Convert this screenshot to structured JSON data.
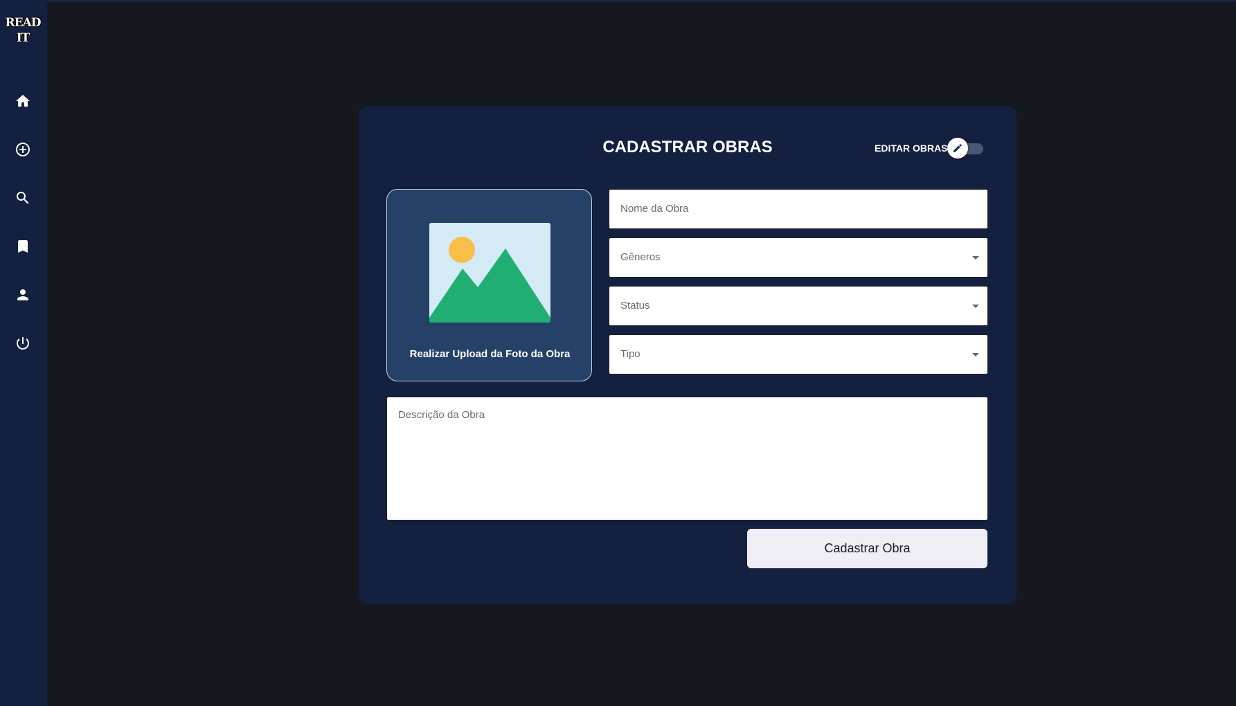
{
  "sidebar": {
    "logo_line1": "READ",
    "logo_line2": "IT",
    "items": [
      {
        "name": "home",
        "icon": "home-icon"
      },
      {
        "name": "add",
        "icon": "add-circle-icon"
      },
      {
        "name": "search",
        "icon": "search-icon"
      },
      {
        "name": "bookmarks",
        "icon": "bookmark-icon"
      },
      {
        "name": "profile",
        "icon": "person-icon"
      },
      {
        "name": "logout",
        "icon": "power-icon"
      }
    ]
  },
  "form": {
    "title": "CADASTRAR OBRAS",
    "edit_toggle_label": "EDITAR OBRAS",
    "edit_toggle_on": false,
    "upload_label": "Realizar Upload da Foto da Obra",
    "name_placeholder": "Nome da Obra",
    "genres_placeholder": "Gêneros",
    "status_placeholder": "Status",
    "type_placeholder": "Tipo",
    "description_placeholder": "Descrição da Obra",
    "submit_label": "Cadastrar Obra"
  },
  "colors": {
    "background": "#15181f",
    "sidebar": "#132040",
    "card": "#132040",
    "upload_box": "#264168",
    "image_sky": "#d4eaf7",
    "image_sun": "#f9be4a",
    "image_mountains": "#21ae72",
    "button": "#efeef4"
  }
}
